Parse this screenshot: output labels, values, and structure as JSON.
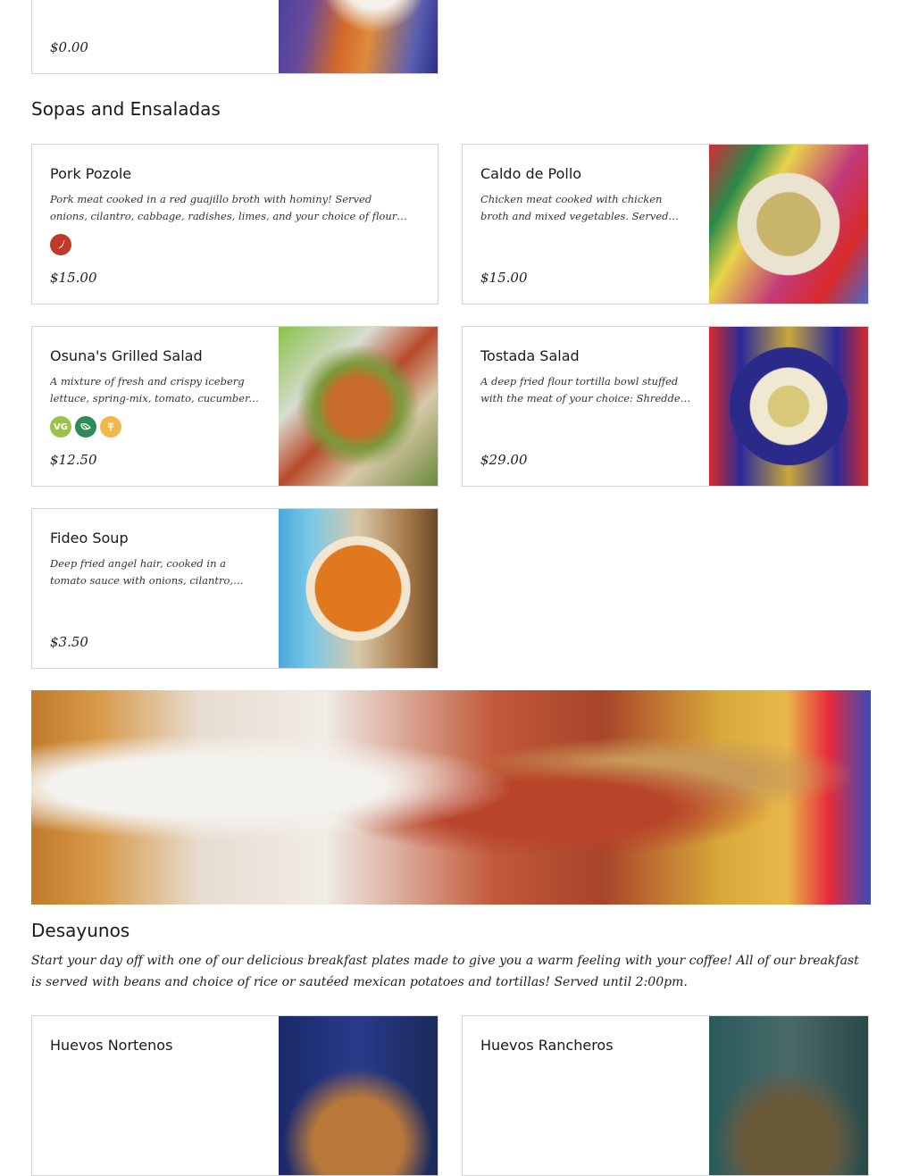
{
  "top_card": {
    "price": "$0.00"
  },
  "sopas": {
    "title": "Sopas and Ensaladas",
    "items": [
      {
        "name": "Pork Pozole",
        "description": "Pork meat cooked in a red guajillo broth with hominy! Served onions, cilantro, cabbage, radishes, limes, and your choice of flour or corn tortillas!",
        "price": "$15.00",
        "badges": [
          "spicy-icon"
        ]
      },
      {
        "name": "Caldo de Pollo",
        "description": "Chicken meat cooked with chicken broth and mixed vegetables. Served with rice, and your...",
        "price": "$15.00",
        "badges": []
      },
      {
        "name": "Osuna's Grilled Salad",
        "description": "A mixture of fresh and crispy iceberg lettuce, spring-mix, tomato, cucumber, carrots, grilled...",
        "price": "$12.50",
        "badges": [
          "vegetarian-icon",
          "vegan-icon",
          "gluten-free-icon"
        ],
        "badge_labels": {
          "vg": "VG"
        }
      },
      {
        "name": "Tostada Salad",
        "description": "A deep fried flour tortilla bowl stuffed with the meat of your choice: Shredded beef, chicken,...",
        "price": "$29.00",
        "badges": []
      },
      {
        "name": "Fideo Soup",
        "description": "Deep fried angel hair, cooked in a tomato sauce with onions, cilantro, celery, carrots, garlic,...",
        "price": "$3.50",
        "badges": []
      }
    ]
  },
  "desayunos": {
    "title": "Desayunos",
    "description": "Start your day off with one of our delicious breakfast plates made to give you a warm feeling with your coffee! All of our breakfast is served with beans and choice of rice or sautéed mexican potatoes and tortillas! Served until 2:00pm.",
    "items": [
      {
        "name": "Huevos Nortenos"
      },
      {
        "name": "Huevos Rancheros"
      }
    ]
  },
  "colors": {
    "spicy": "#c0392b",
    "vegetarian": "#9bc34a",
    "vegan": "#2e8b57",
    "gluten_free": "#f0b84a"
  }
}
